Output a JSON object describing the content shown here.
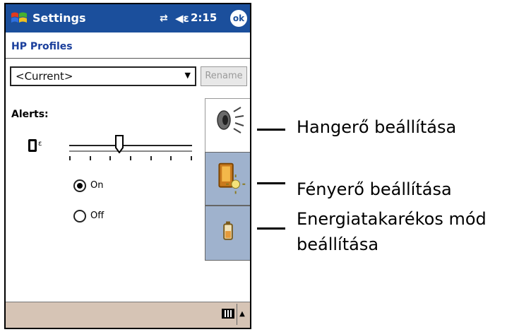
{
  "titlebar": {
    "app_name": "Settings",
    "time": "2:15",
    "ok_label": "ok",
    "accent_color": "#1b4f9c"
  },
  "page": {
    "title": "HP Profiles"
  },
  "profile": {
    "selected": "<Current>",
    "rename_label": "Rename"
  },
  "alerts": {
    "label": "Alerts:",
    "volume_level": 0.4,
    "volume_ticks": 7,
    "radio_on_label": "On",
    "radio_off_label": "Off",
    "selected": "On"
  },
  "tabs": [
    {
      "icon": "speaker-icon",
      "active": true
    },
    {
      "icon": "brightness-icon",
      "active": false
    },
    {
      "icon": "battery-icon",
      "active": false
    }
  ],
  "callouts": {
    "volume": "Hangerő beállítása",
    "brightness": "Fényerő beállítása",
    "power_line1": "Energiatakarékos mód",
    "power_line2": "beállítása"
  }
}
